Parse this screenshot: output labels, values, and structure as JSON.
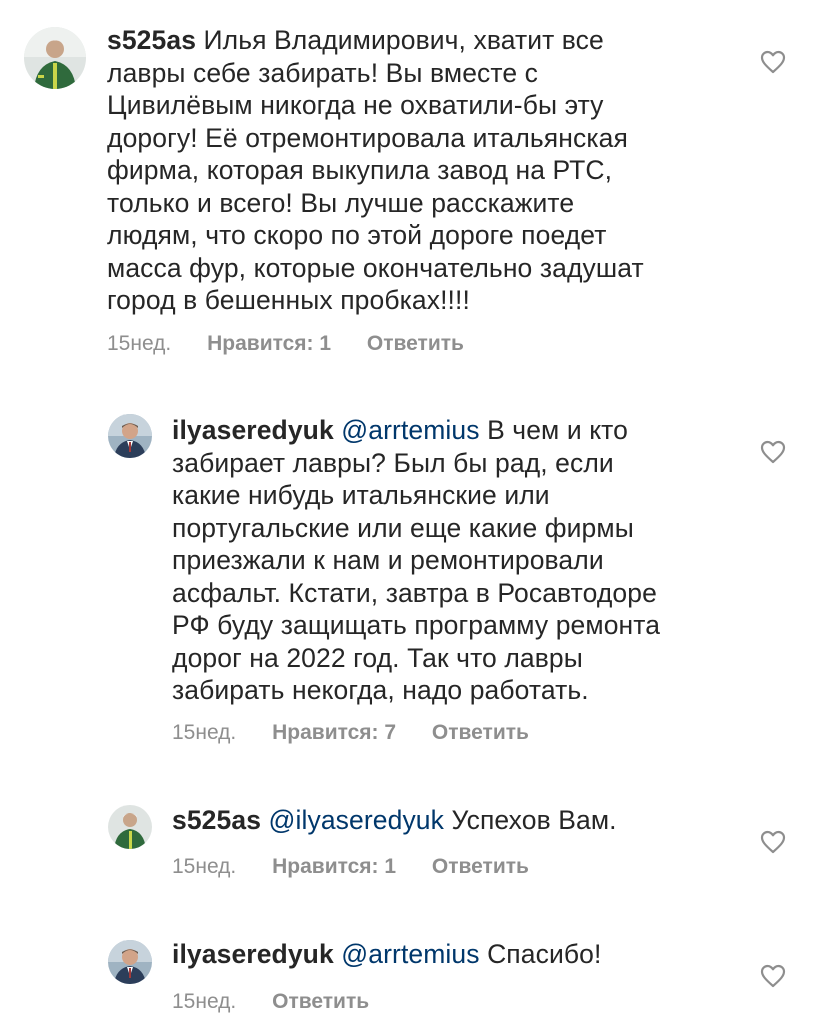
{
  "comments": [
    {
      "username": "s525as",
      "mention": "",
      "lines": [
        "Илья Владимирович, хватит все",
        "лавры себе забирать! Вы вместе с",
        "Цивилёвым никогда  не охватили-бы эту",
        "дорогу! Её отремонтировала итальянская",
        "фирма, которая выкупила завод на РТС,",
        "только и всего! Вы лучше расскажите",
        "людям, что скоро по этой дороге поедет",
        "масса фур, которые окончательно задушат",
        "город  в бешенных пробках!!!!"
      ],
      "time": "15нед.",
      "likes": "Нравится: 1",
      "reply": "Ответить",
      "avatar_icon": "worker-avatar"
    },
    {
      "username": "ilyaseredyuk",
      "mention": "@arrtemius",
      "lines": [
        "В чем и кто",
        "забирает лавры? Был бы рад, если",
        "какие нибудь итальянские или",
        "португальские или еще какие фирмы",
        "приезжали к нам и ремонтировали",
        "асфальт. Кстати, завтра в Росавтодоре",
        "РФ буду защищать программу ремонта",
        "дорог на 2022 год. Так что лавры",
        "забирать некогда, надо работать."
      ],
      "time": "15нед.",
      "likes": "Нравится: 7",
      "reply": "Ответить",
      "avatar_icon": "person-avatar"
    },
    {
      "username": "s525as",
      "mention": "@ilyaseredyuk",
      "lines": [
        "Успехов Вам."
      ],
      "time": "15нед.",
      "likes": "Нравится: 1",
      "reply": "Ответить",
      "avatar_icon": "worker-avatar"
    },
    {
      "username": "ilyaseredyuk",
      "mention": "@arrtemius",
      "lines": [
        "Спасибо!"
      ],
      "time": "15нед.",
      "likes": "",
      "reply": "Ответить",
      "avatar_icon": "person-avatar"
    }
  ],
  "colors": {
    "text": "#262626",
    "mention": "#00376b",
    "meta": "#8e8e8e"
  }
}
